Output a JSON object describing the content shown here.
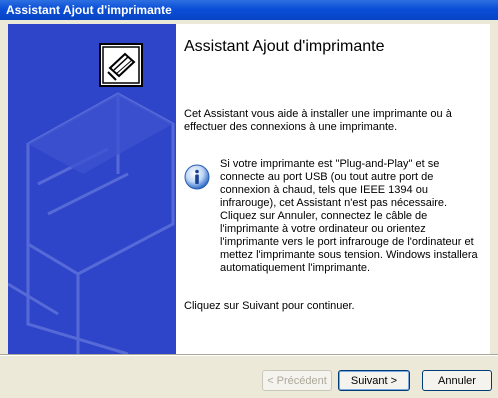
{
  "window": {
    "title": "Assistant Ajout d'imprimante"
  },
  "main": {
    "heading": "Assistant Ajout d'imprimante",
    "intro": "Cet Assistant vous aide à installer une imprimante ou à effectuer des connexions à une imprimante.",
    "note": "Si votre imprimante est \"Plug-and-Play\" et se connecte au port USB (ou tout autre port de connexion à chaud, tels que IEEE 1394 ou infrarouge), cet Assistant n'est pas nécessaire. Cliquez sur Annuler, connectez le câble de l'imprimante à votre ordinateur ou orientez l'imprimante vers le port infrarouge de l'ordinateur et mettez l'imprimante sous tension. Windows installera automatiquement l'imprimante.",
    "footer": "Cliquez sur Suivant pour continuer."
  },
  "buttons": {
    "back": "< Précédent",
    "next": "Suivant >",
    "cancel": "Annuler"
  },
  "icons": {
    "wizard": "printer-wizard-icon",
    "info": "info-icon"
  },
  "colors": {
    "sidebar": "#2E44C9",
    "titlebar": "#0A4FD8"
  }
}
